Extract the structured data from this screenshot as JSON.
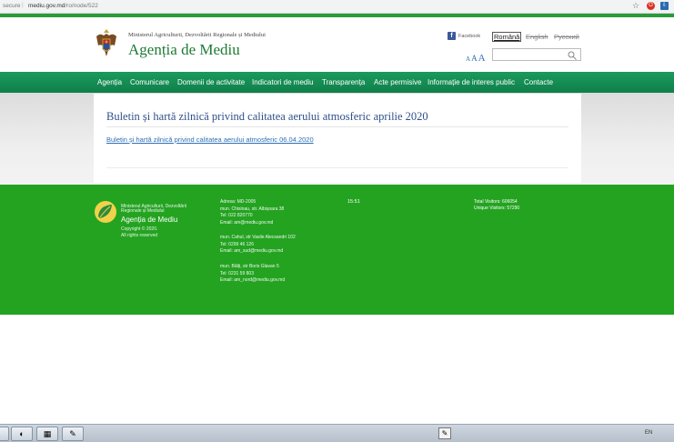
{
  "browser": {
    "secure": "secure",
    "url_host": "mediu.gov.md",
    "url_path": "/ro/node/522"
  },
  "header": {
    "ministry": "Ministerul Agriculturii, Dezvoltării Regionale și Mediului",
    "agency": "Agenția de Mediu",
    "facebook": "Facebook",
    "languages": [
      "Română",
      "English",
      "Русский"
    ],
    "font_sizes": [
      "A",
      "A",
      "A"
    ]
  },
  "nav": {
    "items": [
      "Agenția",
      "Comunicare",
      "Domenii de activitate",
      "Indicatori de mediu",
      "Transparența",
      "Acte permisive",
      "Informație de interes public",
      "Contacte"
    ]
  },
  "content": {
    "title": "Buletin și hartă zilnică privind calitatea aerului atmosferic aprilie 2020",
    "link": "Buletin și hartă zilnică privind calitatea aerului atmosferic 06.04.2020"
  },
  "footer": {
    "ministry": "Ministerul Agriculturii, Dezvoltării Regionale și Mediului",
    "agency": "Agenția de Mediu",
    "copyright": "Copyright © 2020.",
    "rights": "All rights reserved",
    "addr1": [
      "Adresa: MD-2005",
      "mun. Chisinau, str. Albișoara 38",
      "Tel: 022 820770",
      "Email: am@mediu.gov.md"
    ],
    "addr2": [
      "mun. Cahul, str Vasile Alecsandri 102",
      "Tel: 0299 46 126",
      "Email: am_sud@mediu.gov.md"
    ],
    "addr3": [
      "mun. Bălți, str Boris Glavan 5",
      "Tel: 0231 59 803",
      "Email: am_nord@mediu.gov.md"
    ],
    "time": "15:51",
    "total_visitors": "Total Visitors: 606054",
    "unique_visitors": "Unique Visitors: 57290"
  },
  "taskbar": {
    "lang": "EN"
  },
  "colors": {
    "nav_green": "#0f7f49",
    "footer_green": "#24a321",
    "title_blue": "#2d4f8a",
    "link_blue": "#2d6fb5"
  }
}
